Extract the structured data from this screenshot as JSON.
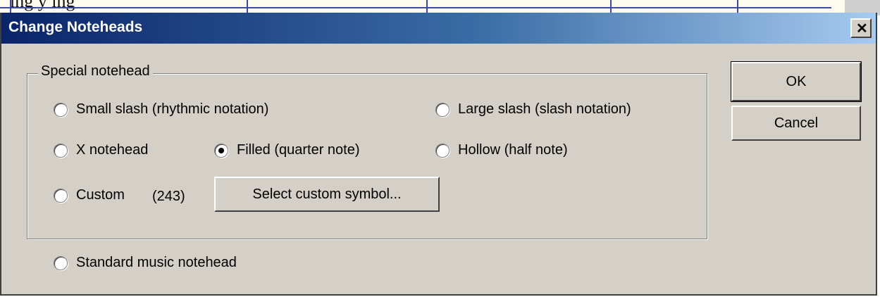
{
  "background": {
    "partial_text": "ing y         ing"
  },
  "dialog": {
    "title": "Change Noteheads",
    "close_glyph": "✕",
    "group": {
      "label": "Special notehead",
      "options": {
        "small_slash": "Small slash (rhythmic notation)",
        "large_slash": "Large slash (slash notation)",
        "x_notehead": "X notehead",
        "filled": "Filled (quarter note)",
        "hollow": "Hollow (half note)",
        "custom": "Custom"
      },
      "selected": "filled",
      "custom_code": "(243)",
      "select_custom_button": "Select custom symbol..."
    },
    "standard_option": "Standard music notehead",
    "ok_button": "OK",
    "cancel_button": "Cancel"
  },
  "colors": {
    "title_gradient_start": "#0a246a",
    "title_gradient_end": "#a6caf0",
    "dialog_face": "#d4d0c8"
  }
}
